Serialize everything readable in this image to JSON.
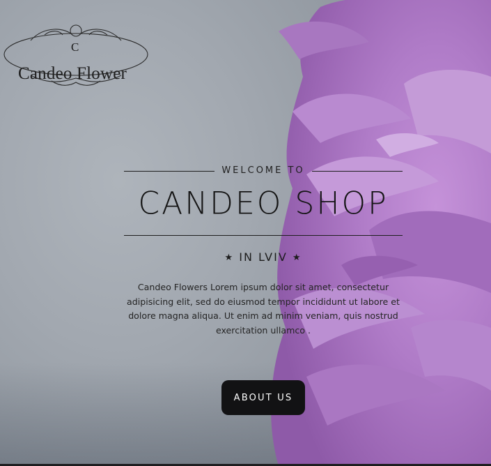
{
  "brand": {
    "logo_text": "Candeo Flower",
    "logo_letter": "C"
  },
  "hero": {
    "welcome": "WELCOME TO",
    "title": "CANDEO SHOP",
    "star_glyph": "★",
    "subtitle": "IN LVIV",
    "description": "Candeo Flowers Lorem ipsum dolor sit amet, consectetur adipisicing elit, sed do eiusmod tempor incididunt ut labore et dolore magna aliqua. Ut enim ad minim veniam, quis nostrud exercitation ullamco .",
    "button_label": "ABOUT US"
  },
  "colors": {
    "background": "#9aa1a9",
    "rose": "#b07cc8",
    "text": "#151515",
    "button": "#121214"
  },
  "icons": {
    "rose_image": "purple-rose-photo",
    "star": "star-icon"
  }
}
